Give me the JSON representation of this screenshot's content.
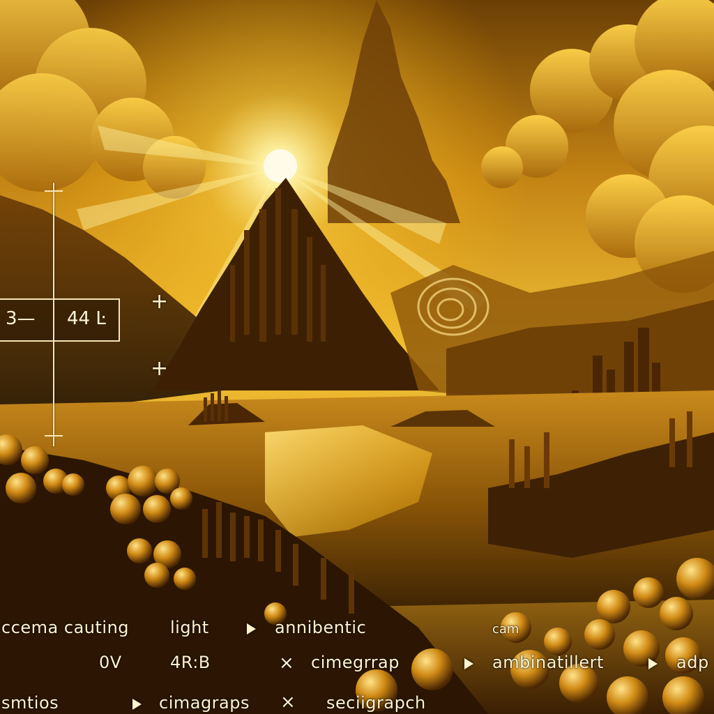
{
  "readout": {
    "left_value": "3—",
    "right_value": "44 Ŀ"
  },
  "overlay_labels": {
    "row1": [
      "ccema cauting",
      "light",
      "annibentic",
      "cam"
    ],
    "row2": [
      "0V",
      "4R:B",
      "cimegrrap",
      "ambinatillert",
      "adp"
    ],
    "row3": [
      "smtios",
      "cimagraps",
      "seciigrapch"
    ]
  },
  "colors": {
    "sky_top": "#7a4a06",
    "sun": "#fffbe0",
    "glow": "#ffd23a",
    "hud_text": "#fff4cf"
  },
  "icons": [
    "crosshair-plus-icon",
    "play-triangle-icon",
    "close-x-icon"
  ]
}
